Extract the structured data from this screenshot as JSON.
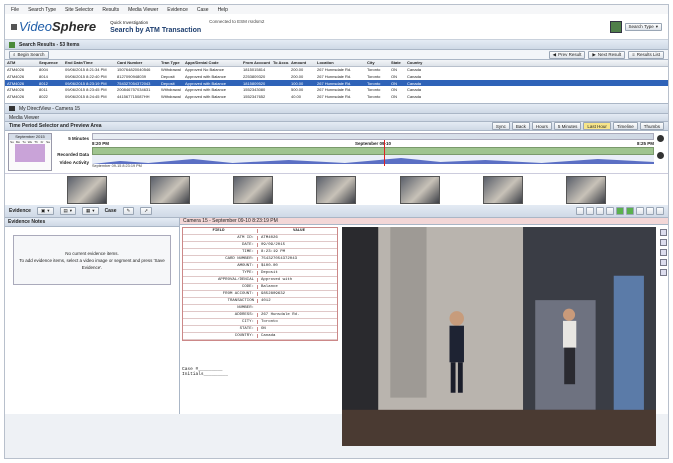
{
  "menu": [
    "File",
    "Search Type",
    "Site Selector",
    "Results",
    "Media Viewer",
    "Evidence",
    "Case",
    "Help"
  ],
  "brand": {
    "prefix": "Video",
    "suffix": "Sphere",
    "caption": "Search by ATM Transaction",
    "line1": "Quick Investigation",
    "line2": "Connected to ESM rsrdsm2"
  },
  "search_type_label": "Search Type",
  "results": {
    "title": "Search Results - 53 Items",
    "begin_search": "Begin Search",
    "prev": "Prev Result",
    "next": "Next Result",
    "list": "Results List",
    "columns": [
      "ATM",
      "Sequence",
      "End Date/Time",
      "Card Number",
      "Tran Type",
      "Appr/Denial Code",
      "From Account",
      "To Acco...",
      "Amount",
      "Location",
      "City",
      "State",
      "Country"
    ],
    "rows": [
      [
        "ATM4026",
        "8004",
        "09/06/2015 8:21:34 PM",
        "150764820040546",
        "Withdrawal",
        "Approved No Balance",
        "1815015814",
        "",
        "200.00",
        "267 Hunnsdale Rd.",
        "Toronto",
        "ON",
        "Canada"
      ],
      [
        "ATM4026",
        "8014",
        "09/06/2015 8:22:40 PM",
        "8127090948039",
        "Deposit",
        "Approved with Balance",
        "2253809320",
        "",
        "200.00",
        "267 Hunnsdale Rd.",
        "Toronto",
        "ON",
        "Canada"
      ],
      [
        "ATM4026",
        "8012",
        "09/06/2015 8:23:19 PM",
        "754327054372043",
        "Deposit",
        "Approved with Balance",
        "1815809520",
        "",
        "100.00",
        "267 Hunnsdale Rd.",
        "Toronto",
        "ON",
        "Canada"
      ],
      [
        "ATM4026",
        "8011",
        "09/06/2015 8:23:45 PM",
        "200846757034631",
        "Withdrawal",
        "Approved with Balance",
        "1552343080",
        "",
        "500.00",
        "267 Hunnsdale Rd.",
        "Toronto",
        "ON",
        "Canada"
      ],
      [
        "ATM4026",
        "8022",
        "09/06/2015 8:24:45 PM",
        "441567715087HH",
        "Withdrawal",
        "Approved with Balance",
        "1552347652",
        "",
        "40.00",
        "267 Hunnsdale Rd.",
        "Toronto",
        "ON",
        "Canada"
      ]
    ]
  },
  "viewer": {
    "title": "My DirectView - Camera 15",
    "media_viewer": "Media Viewer",
    "time_period_label": "Time Period Selector and Preview Area",
    "month": "September 2015",
    "dow": [
      "Su",
      "Mo",
      "Tu",
      "We",
      "Th",
      "Fr",
      "Sa"
    ],
    "interval": "5 Minutes",
    "rec_label": "Recorded Data",
    "act_label": "Video Activity",
    "start_time": "8:20 PM",
    "end_time": "8:25 PM",
    "date_marker": "September 09-10",
    "cursor_time": "September 09-15 8:23:19 PM",
    "nav_buttons": [
      "Sync",
      "Back",
      "Hours",
      "5 Minutes",
      "Last Hour",
      "Timeline",
      "Thumbs"
    ]
  },
  "evidence": {
    "title": "Evidence Notes",
    "toolbar": "Evidence",
    "case": "Case",
    "empty_line1": "No current evidence items.",
    "empty_line2": "To add evidence items, select a video image or segment and press 'Save Evidence'."
  },
  "camera": {
    "title": "Camera 15 - September 09-10 8:23:19 PM",
    "field_header": "FIELD",
    "value_header": "VALUE",
    "fields": [
      [
        "ATM ID:",
        "ATM4026"
      ],
      [
        "DATE:",
        "09/09/2015"
      ],
      [
        "TIME:",
        "8:23:19 PM"
      ],
      [
        "CARD NUMBER:",
        "754327054372043"
      ],
      [
        "AMOUNT:",
        "$100.00"
      ],
      [
        "TYPE:",
        "Deposit"
      ],
      [
        "APPROVAL/DENIAL",
        "Approved with"
      ],
      [
        "CODE:",
        "Balance"
      ],
      [
        "FROM ACCOUNT:",
        "9852809632"
      ],
      [
        "TRANSACTION",
        "4012"
      ],
      [
        "NUMBER:",
        ""
      ],
      [
        "ADDRESS:",
        "267 Hunsdale Rd."
      ],
      [
        "CITY:",
        "Toronto"
      ],
      [
        "STATE:",
        "ON"
      ],
      [
        "COUNTRY:",
        "Canada"
      ]
    ],
    "case_label": "Case #",
    "initials_label": "Initials"
  }
}
